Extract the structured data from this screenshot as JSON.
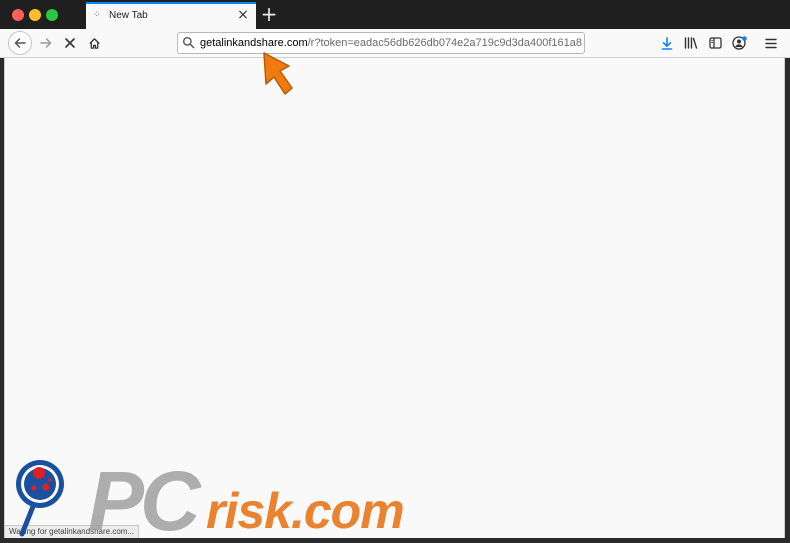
{
  "tab": {
    "title": "New Tab",
    "favicon": "new-tab-favicon"
  },
  "address_bar": {
    "domain": "getalinkandshare.com",
    "path": "/r?token=eadac56db626db074e2a719c9d3da400f161a8"
  },
  "status_bar": {
    "text": "Waiting for getalinkandshare.com..."
  },
  "watermark": {
    "brand_pc": "PC",
    "brand_risk": "risk.com"
  },
  "colors": {
    "accent": "#0a84ff",
    "arrow": "#f07c0f",
    "watermark_gray": "#9a9a9a",
    "watermark_orange": "#e8751a",
    "watermark_red": "#e02020",
    "watermark_blue": "#1b4fa0"
  }
}
